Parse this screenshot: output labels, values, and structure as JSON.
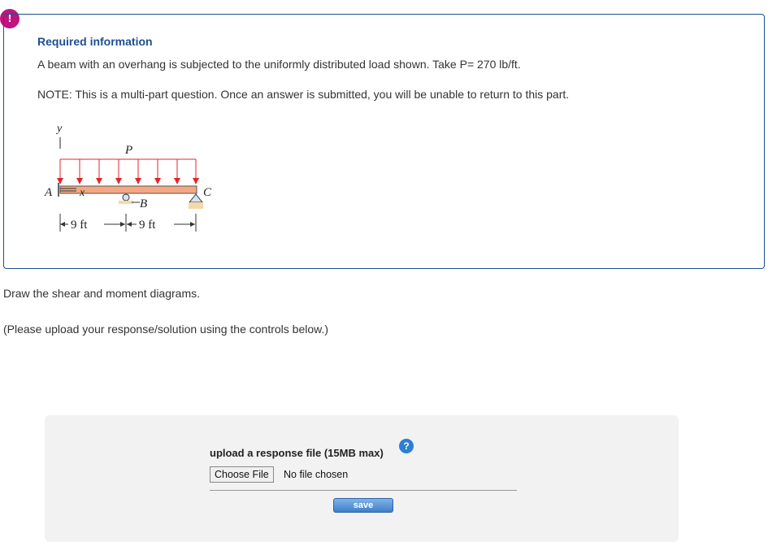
{
  "alert": {
    "icon": "exclamation-icon",
    "glyph": "!"
  },
  "required": {
    "title": "Required information",
    "description": "A beam with an overhang is subjected to the uniformly distributed load shown. Take P= 270 lb/ft.",
    "note": "NOTE: This is a multi-part question. Once an answer is submitted, you will be unable to return to this part."
  },
  "figure": {
    "y_label": "y",
    "load_label": "P",
    "point_a": "A",
    "x_label": "x",
    "point_b": "B",
    "point_c": "C",
    "dim1": "9 ft",
    "dim2": "9 ft"
  },
  "question": {
    "instruction": "Draw the shear and moment diagrams.",
    "upload_note": "(Please upload your response/solution using the controls below.)"
  },
  "upload": {
    "label": "upload a response file (15MB max)",
    "help": "?",
    "choose_file": "Choose File",
    "status": "No file chosen",
    "save": "save"
  },
  "colors": {
    "accent": "#1d4f91",
    "alert": "#c0137e",
    "load": "#e0262b",
    "beam": "#f2a883"
  }
}
